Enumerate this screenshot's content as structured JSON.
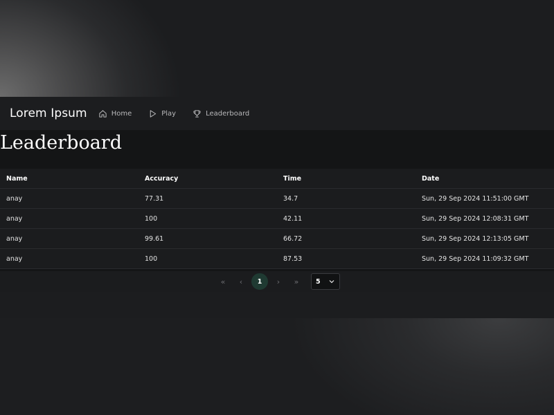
{
  "brand": "Lorem Ipsum",
  "nav": [
    {
      "label": "Home",
      "icon": "home-icon"
    },
    {
      "label": "Play",
      "icon": "play-icon"
    },
    {
      "label": "Leaderboard",
      "icon": "trophy-icon"
    }
  ],
  "page_title": "Leaderboard",
  "table": {
    "columns": [
      "Name",
      "Accuracy",
      "Time",
      "Date"
    ],
    "rows": [
      [
        "anay",
        "77.31",
        "34.7",
        "Sun, 29 Sep 2024 11:51:00 GMT"
      ],
      [
        "anay",
        "100",
        "42.11",
        "Sun, 29 Sep 2024 12:08:31 GMT"
      ],
      [
        "anay",
        "99.61",
        "66.72",
        "Sun, 29 Sep 2024 12:13:05 GMT"
      ],
      [
        "anay",
        "100",
        "87.53",
        "Sun, 29 Sep 2024 11:09:32 GMT"
      ]
    ]
  },
  "pagination": {
    "current_page": "1",
    "page_size": "5",
    "first": "«",
    "prev": "‹",
    "next": "›",
    "last": "»"
  },
  "colors": {
    "accent": "#1f3a32",
    "background": "#141516"
  }
}
